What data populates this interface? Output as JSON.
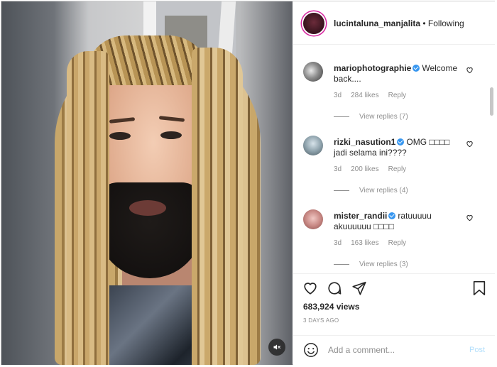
{
  "header": {
    "username": "lucintaluna_manjalita",
    "separator": " • ",
    "follow_status": "Following"
  },
  "comments": [
    {
      "user": "mariophotographie",
      "text": "Welcome back....",
      "time": "3d",
      "likes": "284 likes",
      "reply": "Reply",
      "view_replies": "View replies (7)"
    },
    {
      "user": "rizki_nasution1",
      "text": "OMG □□□□ jadi selama ini????",
      "time": "3d",
      "likes": "200 likes",
      "reply": "Reply",
      "view_replies": "View replies (4)"
    },
    {
      "user": "mister_randii",
      "text": "ratuuuuu akuuuuuu □□□□",
      "time": "3d",
      "likes": "163 likes",
      "reply": "Reply",
      "view_replies": "View replies (3)"
    }
  ],
  "stats": {
    "views": "683,924 views",
    "date": "3 DAYS AGO"
  },
  "add_comment": {
    "placeholder": "Add a comment...",
    "post_label": "Post"
  },
  "colors": {
    "verified": "#3897f0",
    "post_disabled": "#b2dffc",
    "secondary_text": "#8e8e8e"
  }
}
